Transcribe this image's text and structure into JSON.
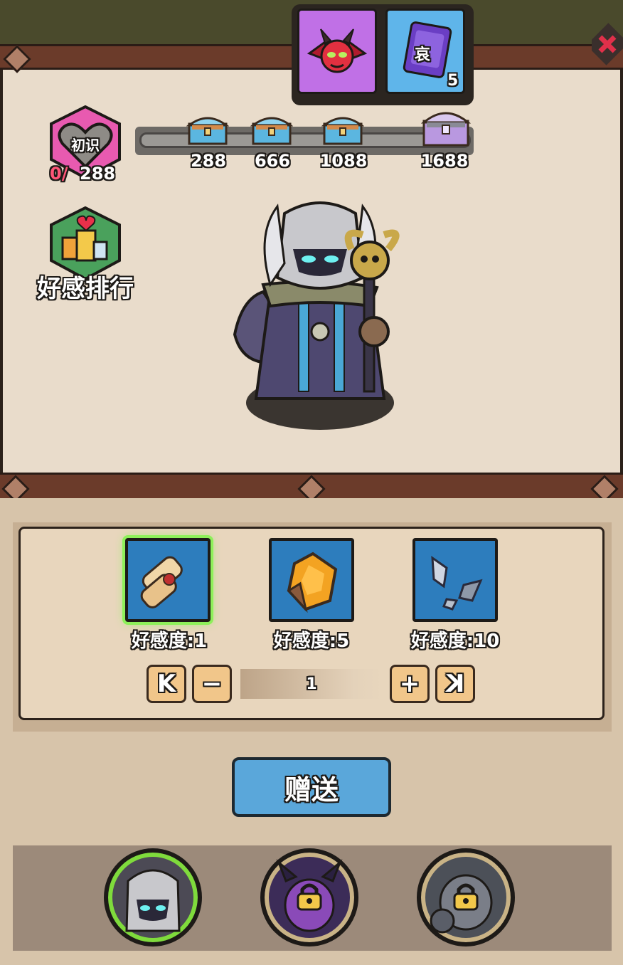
{
  "top_tabs": {
    "devil_icon": "devil-mask-icon",
    "card_icon": "scroll-card-icon",
    "card_glyph": "哀",
    "card_count": "5"
  },
  "affection": {
    "level": "初识",
    "current": "0/",
    "max": "288",
    "milestones": [
      {
        "value": "288",
        "icon": "blue-chest-icon"
      },
      {
        "value": "666",
        "icon": "blue-chest-icon"
      },
      {
        "value": "1088",
        "icon": "blue-chest-icon"
      },
      {
        "value": "1688",
        "icon": "purple-chest-icon"
      }
    ],
    "progress_fraction": 0
  },
  "ranking": {
    "label": "好感排行",
    "icon": "gift-ranking-icon"
  },
  "gifts": [
    {
      "label": "好感度:1",
      "icon": "scroll-icon",
      "selected": true
    },
    {
      "label": "好感度:5",
      "icon": "amber-gem-icon",
      "selected": false
    },
    {
      "label": "好感度:10",
      "icon": "crystal-shards-icon",
      "selected": false
    }
  ],
  "stepper": {
    "first_label": "K",
    "minus_label": "−",
    "value": "1",
    "plus_label": "+",
    "last_label": "K"
  },
  "send_button": {
    "label": "赠送"
  },
  "heroes": [
    {
      "icon": "knight-portrait-icon",
      "locked": false,
      "selected": true
    },
    {
      "icon": "demon-portrait-icon",
      "locked": true,
      "selected": false
    },
    {
      "icon": "armored-portrait-icon",
      "locked": true,
      "selected": false
    }
  ],
  "colors": {
    "accent_green": "#7fdb3c",
    "progress_red": "#ff5577",
    "send_blue": "#5aa7da",
    "devil_tab": "#c070e6",
    "card_tab": "#5fb5ea"
  }
}
